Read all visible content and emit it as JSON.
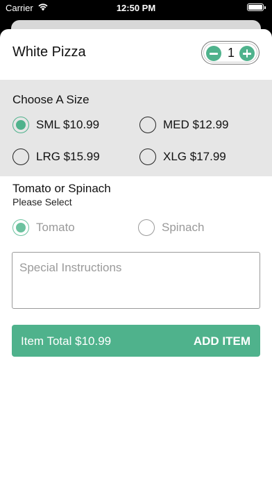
{
  "status_bar": {
    "carrier": "Carrier",
    "time": "12:50 PM",
    "wifi_icon": "wifi-icon",
    "battery_icon": "battery-icon",
    "battery_level": 1.0
  },
  "item": {
    "title": "White Pizza",
    "quantity": "1",
    "minus_icon": "minus-circle-icon",
    "plus_icon": "plus-circle-icon"
  },
  "size_section": {
    "title": "Choose A Size",
    "options": [
      {
        "label": "SML $10.99",
        "selected": true
      },
      {
        "label": "MED $12.99",
        "selected": false
      },
      {
        "label": "LRG $15.99",
        "selected": false
      },
      {
        "label": "XLG $17.99",
        "selected": false
      }
    ]
  },
  "topping_section": {
    "title": "Tomato or Spinach",
    "subtitle": "Please Select",
    "options": [
      {
        "label": "Tomato",
        "selected": true
      },
      {
        "label": "Spinach",
        "selected": false
      }
    ]
  },
  "instructions": {
    "placeholder": "Special Instructions",
    "value": ""
  },
  "add_bar": {
    "total_label": "Item Total $10.99",
    "button_label": "ADD ITEM"
  },
  "colors": {
    "accent": "#4fb28c",
    "section_background": "#e6e6e6"
  }
}
